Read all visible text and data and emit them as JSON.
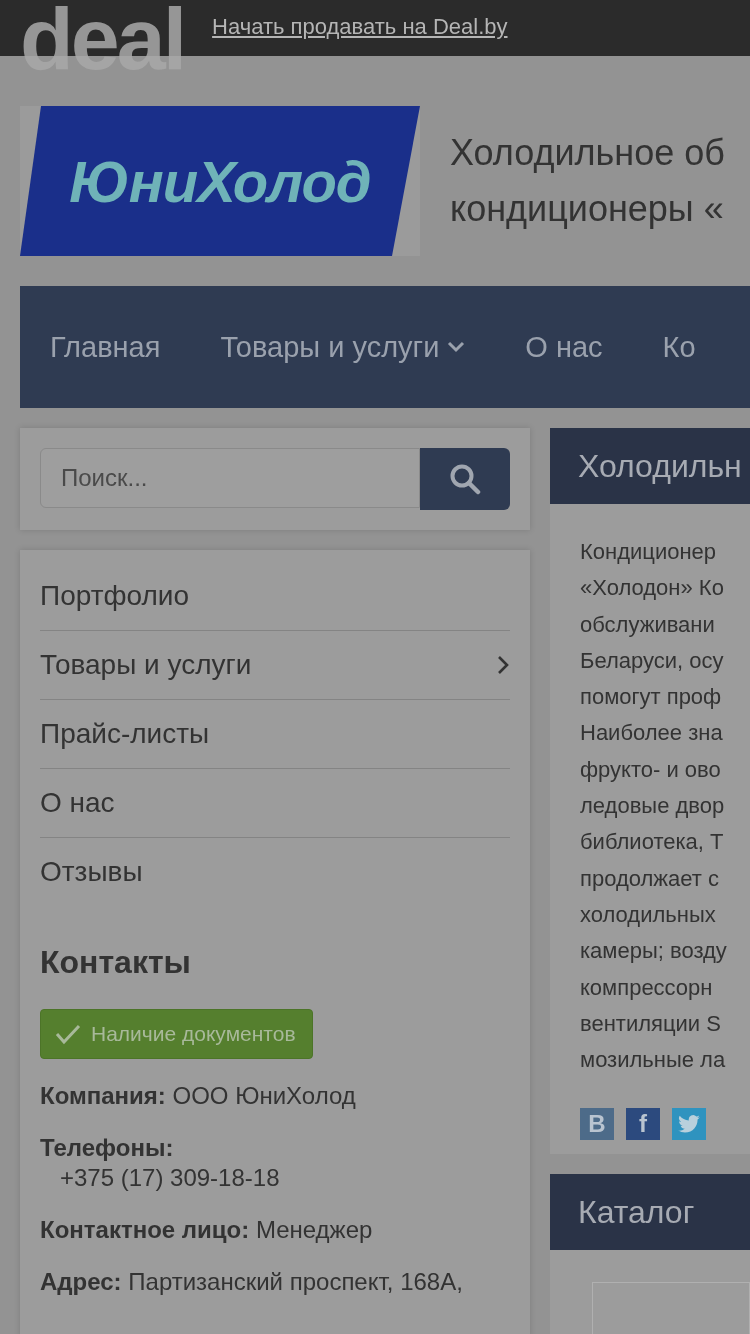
{
  "top_bar": {
    "logo_text": "deal",
    "link": "Начать продавать на Deal.by"
  },
  "header": {
    "logo_text": "ЮниХолод",
    "title_lines": [
      "Холодильное об",
      "кондиционеры «"
    ]
  },
  "nav": [
    {
      "label": "Главная",
      "dropdown": false
    },
    {
      "label": "Товары и услуги",
      "dropdown": true
    },
    {
      "label": "О нас",
      "dropdown": false
    },
    {
      "label": "Ко",
      "dropdown": false
    }
  ],
  "search": {
    "placeholder": "Поиск..."
  },
  "menu": [
    {
      "label": "Портфолио",
      "submenu": false
    },
    {
      "label": "Товары и услуги",
      "submenu": true
    },
    {
      "label": "Прайс-листы",
      "submenu": false
    },
    {
      "label": "О нас",
      "submenu": false
    },
    {
      "label": "Отзывы",
      "submenu": false
    }
  ],
  "contacts": {
    "title": "Контакты",
    "badge": "Наличие документов",
    "fields": [
      {
        "kind": "inline",
        "label": "Компания:",
        "value": "ООО ЮниХолод"
      },
      {
        "kind": "block",
        "label": "Телефоны:",
        "value": "+375 (17) 309-18-18"
      },
      {
        "kind": "inline",
        "label": "Контактное лицо:",
        "value": "Менеджер"
      },
      {
        "kind": "inline",
        "label": "Адрес:",
        "value": "Партизанский проспект, 168А,"
      }
    ]
  },
  "main": {
    "title": "Холодильн",
    "lines": [
      "Кондиционер",
      "«Холодон» Ко",
      "обслуживани",
      "Беларуси, осу",
      "помогут проф",
      "Наиболее зна",
      "фрукто- и ово",
      "ледовые двор",
      "библиотека, Т",
      "продолжает с",
      "холодильных",
      "камеры; возду",
      "компрессорн",
      "вентиляции S",
      "мозильные ла"
    ],
    "social": [
      {
        "kind": "vk",
        "glyph": "B"
      },
      {
        "kind": "facebook",
        "glyph": "f"
      },
      {
        "kind": "twitter"
      }
    ]
  },
  "catalog": {
    "title": "Каталог"
  }
}
